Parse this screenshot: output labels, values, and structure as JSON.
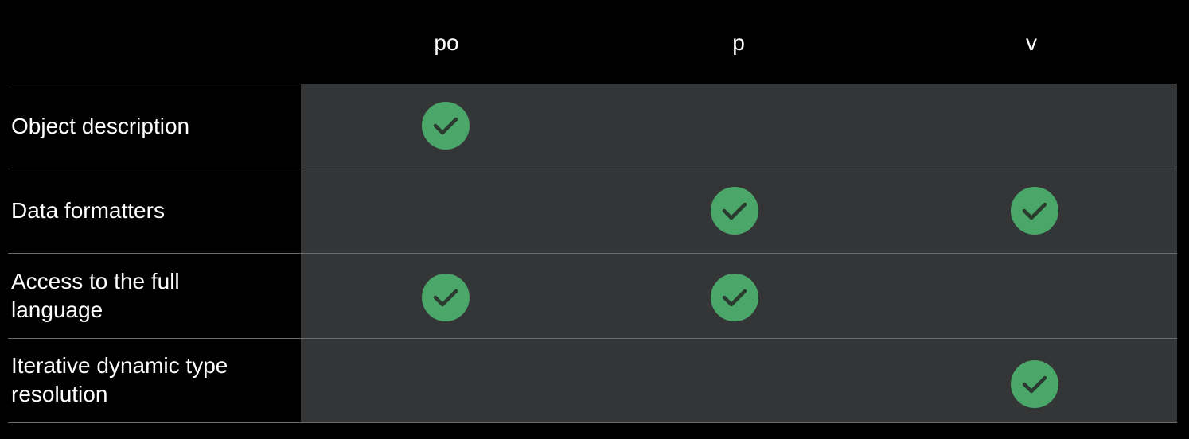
{
  "columns": [
    {
      "label": "po"
    },
    {
      "label": "p"
    },
    {
      "label": "v"
    }
  ],
  "rows": [
    {
      "label": "Object description",
      "checks": [
        true,
        false,
        false
      ]
    },
    {
      "label": "Data formatters",
      "checks": [
        false,
        true,
        true
      ]
    },
    {
      "label": "Access to the full language",
      "checks": [
        true,
        true,
        false
      ]
    },
    {
      "label": "Iterative dynamic type resolution",
      "checks": [
        false,
        false,
        true
      ]
    }
  ],
  "colors": {
    "background": "#000000",
    "panel": "#343537",
    "divider": "#6a6b6d",
    "check_fill": "#4ba66a",
    "check_mark": "#2a3a2f"
  },
  "icons": {
    "check": "checkmark-circle-icon"
  }
}
